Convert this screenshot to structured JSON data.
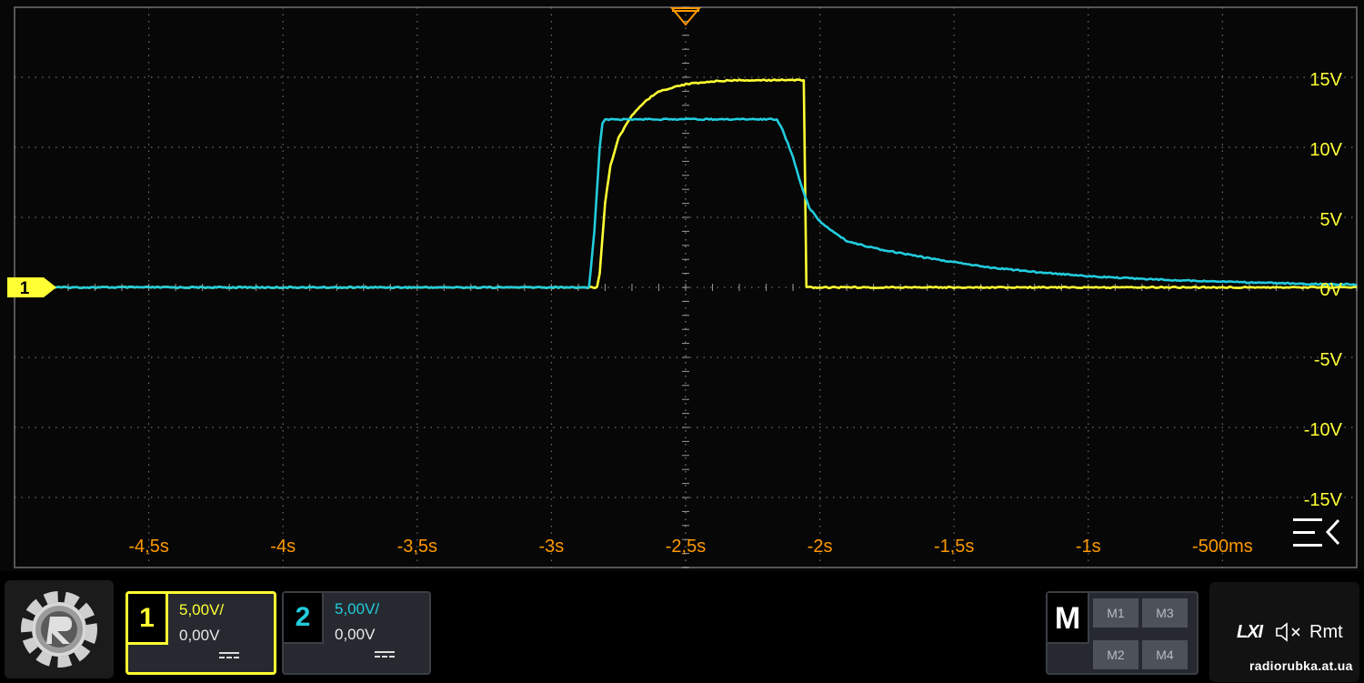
{
  "chart_data": {
    "type": "line",
    "title": "",
    "xlabel": "",
    "ylabel": "",
    "x_ticks": [
      "-4,5s",
      "-4s",
      "-3,5s",
      "-3s",
      "-2,5s",
      "-2s",
      "-1,5s",
      "-1s",
      "-500ms"
    ],
    "y_ticks": [
      "15V",
      "10V",
      "5V",
      "0V",
      "-5V",
      "-10V",
      "-15V"
    ],
    "xlim_s": [
      -5.0,
      0.0
    ],
    "ylim_V": [
      -20,
      20
    ],
    "grid": true,
    "series": [
      {
        "channel": "1",
        "color": "#ffff33",
        "points_s_V": [
          [
            -5.0,
            0
          ],
          [
            -2.83,
            0
          ],
          [
            -2.82,
            1
          ],
          [
            -2.8,
            6
          ],
          [
            -2.78,
            8.7
          ],
          [
            -2.75,
            10.7
          ],
          [
            -2.7,
            12.3
          ],
          [
            -2.65,
            13.3
          ],
          [
            -2.6,
            14.0
          ],
          [
            -2.5,
            14.5
          ],
          [
            -2.4,
            14.7
          ],
          [
            -2.3,
            14.8
          ],
          [
            -2.06,
            14.8
          ],
          [
            -2.05,
            0
          ],
          [
            0.0,
            0
          ]
        ]
      },
      {
        "channel": "2",
        "color": "#22ccdd",
        "points_s_V": [
          [
            -5.0,
            0
          ],
          [
            -2.86,
            0
          ],
          [
            -2.84,
            4
          ],
          [
            -2.82,
            10
          ],
          [
            -2.81,
            11.7
          ],
          [
            -2.8,
            12.0
          ],
          [
            -2.16,
            12.0
          ],
          [
            -2.14,
            11.3
          ],
          [
            -2.1,
            9.3
          ],
          [
            -2.07,
            7.3
          ],
          [
            -2.04,
            5.7
          ],
          [
            -2.0,
            4.7
          ],
          [
            -1.9,
            3.3
          ],
          [
            -1.8,
            2.8
          ],
          [
            -1.6,
            2.1
          ],
          [
            -1.4,
            1.5
          ],
          [
            -1.2,
            1.1
          ],
          [
            -1.0,
            0.8
          ],
          [
            -0.8,
            0.6
          ],
          [
            -0.5,
            0.4
          ],
          [
            -0.2,
            0.25
          ],
          [
            0.0,
            0.2
          ]
        ]
      }
    ],
    "trigger_time_s": -2.5
  },
  "scope": {
    "ch1_marker_label": "1",
    "grid_color": "#7a7a7a",
    "axis_label_color_y": "#ffff33",
    "axis_label_color_x": "#ff9900",
    "trigger_color": "#ff9900",
    "menu_icon": "collapse-menu-icon"
  },
  "channels": [
    {
      "label": "1",
      "scale": "5,00V/",
      "offset": "0,00V",
      "color": "#ffff33",
      "coupling_icon": "dc-coupling-icon"
    },
    {
      "label": "2",
      "scale": "5,00V/",
      "offset": "0,00V",
      "color": "#22ccdd",
      "coupling_icon": "dc-coupling-icon"
    }
  ],
  "math": {
    "label": "M",
    "buttons": [
      "M1",
      "M3",
      "M2",
      "M4"
    ]
  },
  "status": {
    "lxi": "LXI",
    "rmt": "Rmt",
    "speaker_icon": "speaker-muted-icon"
  },
  "logo_icon": "gear-logo-icon",
  "watermark": "radiorubka.at.ua"
}
